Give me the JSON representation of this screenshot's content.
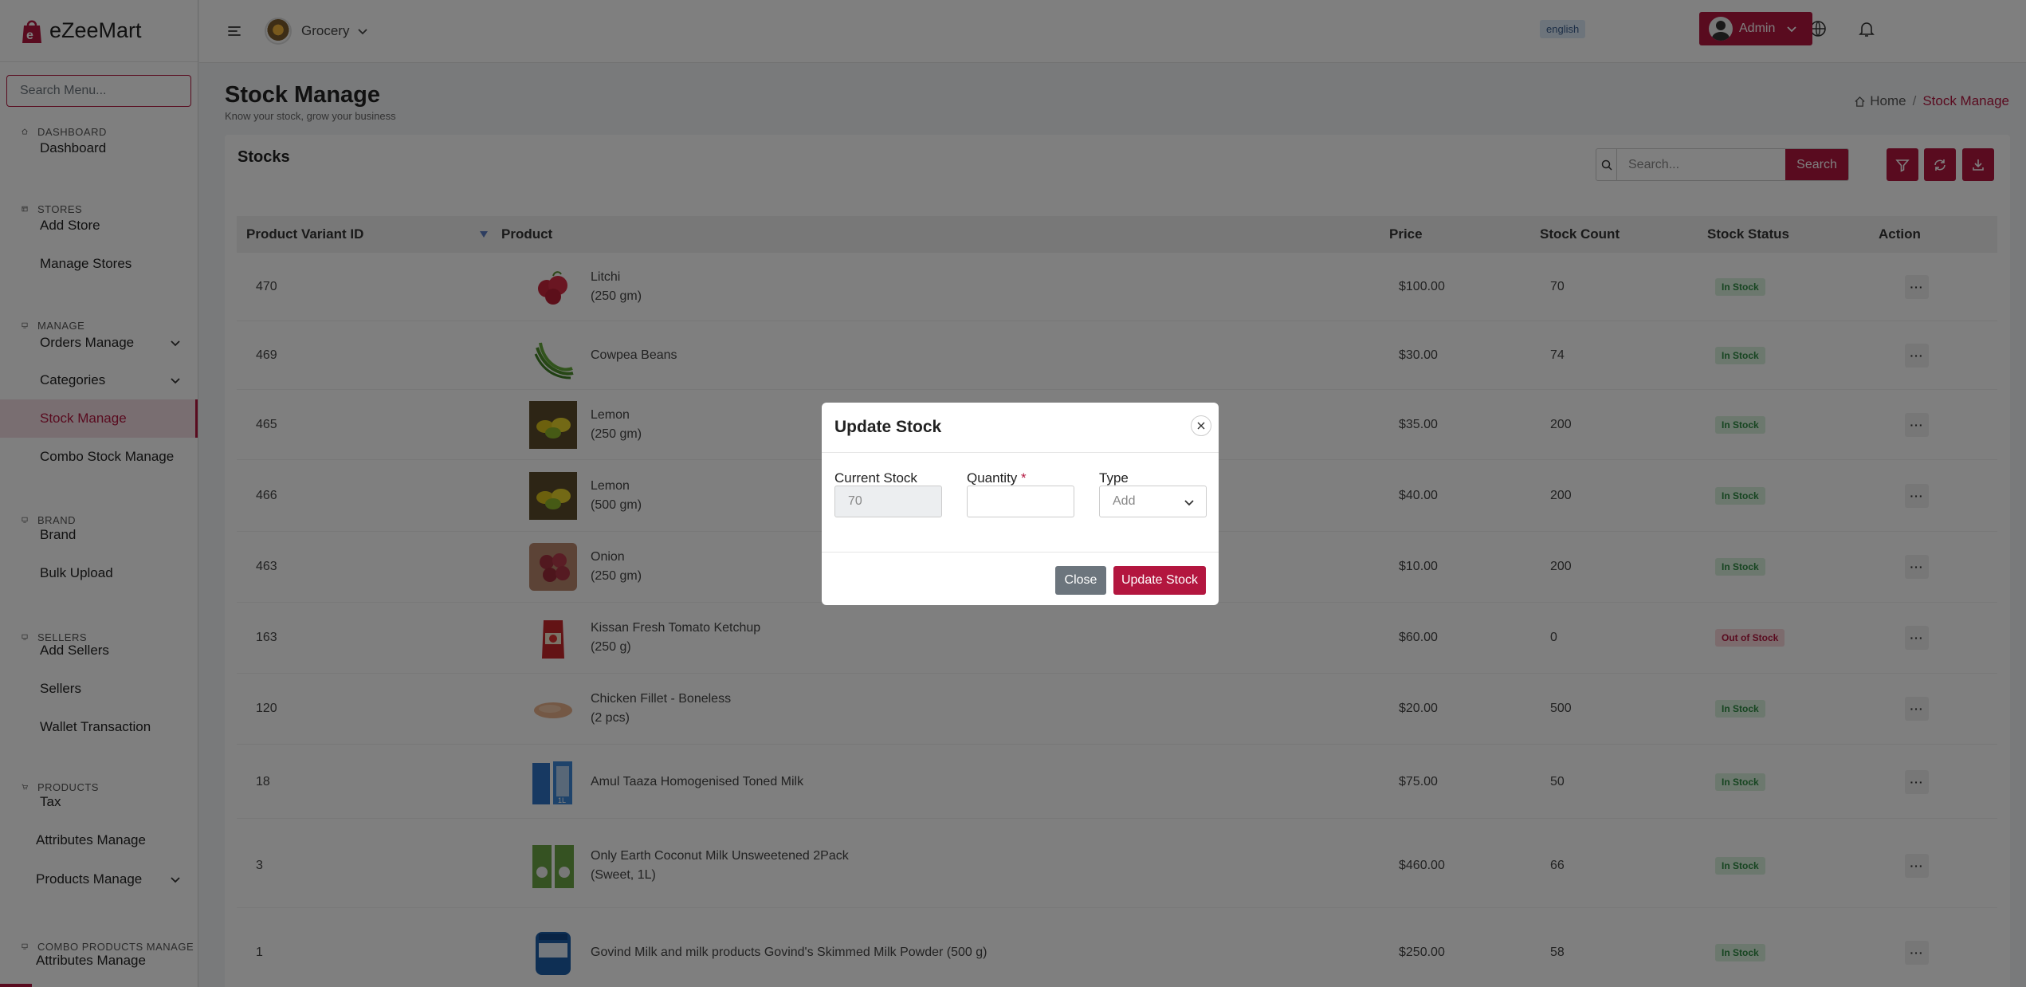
{
  "app": {
    "brand": "eZeeMart"
  },
  "sidebar": {
    "search_placeholder": "Search Menu...",
    "sections": [
      {
        "title": "DASHBOARD",
        "icon": "home-icon",
        "items": [
          {
            "label": "Dashboard"
          }
        ]
      },
      {
        "title": "STORES",
        "icon": "store-icon",
        "items": [
          {
            "label": "Add Store"
          },
          {
            "label": "Manage Stores"
          }
        ]
      },
      {
        "title": "MANAGE",
        "icon": "monitor-icon",
        "items": [
          {
            "label": "Orders Manage",
            "chevron": true
          },
          {
            "label": "Categories",
            "chevron": true
          },
          {
            "label": "Stock Manage",
            "active": true
          },
          {
            "label": "Combo Stock Manage"
          }
        ]
      },
      {
        "title": "BRAND",
        "icon": "monitor-icon",
        "items": [
          {
            "label": "Brand"
          },
          {
            "label": "Bulk Upload"
          }
        ]
      },
      {
        "title": "SELLERS",
        "icon": "monitor-icon",
        "items": [
          {
            "label": "Add Sellers"
          },
          {
            "label": "Sellers"
          },
          {
            "label": "Wallet Transaction"
          }
        ]
      },
      {
        "title": "PRODUCTS",
        "icon": "cart-icon",
        "items": [
          {
            "label": "Tax"
          },
          {
            "label": "Attributes Manage"
          },
          {
            "label": "Products Manage",
            "chevron": true
          }
        ]
      },
      {
        "title": "COMBO PRODUCTS MANAGE",
        "icon": "monitor-icon",
        "items": [
          {
            "label": "Attributes Manage"
          }
        ]
      }
    ]
  },
  "topbar": {
    "store_name": "Grocery",
    "language": "english",
    "user": "Admin"
  },
  "page": {
    "title": "Stock Manage",
    "subtitle": "Know your stock, grow your business",
    "breadcrumb_home": "Home",
    "breadcrumb_sep": "/",
    "breadcrumb_current": "Stock Manage"
  },
  "stocks": {
    "title": "Stocks",
    "search_placeholder": "Search...",
    "search_button": "Search",
    "columns": {
      "id": "Product Variant ID",
      "product": "Product",
      "price": "Price",
      "count": "Stock Count",
      "status": "Stock Status",
      "action": "Action"
    },
    "rows": [
      {
        "id": "470",
        "name": "Litchi",
        "variant": "(250 gm)",
        "price": "$100.00",
        "count": "70",
        "status": "In Stock",
        "in": true,
        "thumb": "litchi"
      },
      {
        "id": "469",
        "name": "Cowpea Beans",
        "variant": "",
        "price": "$30.00",
        "count": "74",
        "status": "In Stock",
        "in": true,
        "thumb": "beans"
      },
      {
        "id": "465",
        "name": "Lemon",
        "variant": "(250 gm)",
        "price": "$35.00",
        "count": "200",
        "status": "In Stock",
        "in": true,
        "thumb": "lemon"
      },
      {
        "id": "466",
        "name": "Lemon",
        "variant": "(500 gm)",
        "price": "$40.00",
        "count": "200",
        "status": "In Stock",
        "in": true,
        "thumb": "lemon"
      },
      {
        "id": "463",
        "name": "Onion",
        "variant": "(250 gm)",
        "price": "$10.00",
        "count": "200",
        "status": "In Stock",
        "in": true,
        "thumb": "onion"
      },
      {
        "id": "163",
        "name": "Kissan Fresh Tomato Ketchup",
        "variant": "(250 g)",
        "price": "$60.00",
        "count": "0",
        "status": "Out of Stock",
        "in": false,
        "thumb": "ketchup"
      },
      {
        "id": "120",
        "name": "Chicken Fillet - Boneless",
        "variant": "(2 pcs)",
        "price": "$20.00",
        "count": "500",
        "status": "In Stock",
        "in": true,
        "thumb": "chicken"
      },
      {
        "id": "18",
        "name": "Amul Taaza Homogenised Toned Milk",
        "variant": "",
        "price": "$75.00",
        "count": "50",
        "status": "In Stock",
        "in": true,
        "thumb": "milk"
      },
      {
        "id": "3",
        "name": "Only Earth Coconut Milk Unsweetened 2Pack",
        "variant": "(Sweet, 1L)",
        "price": "$460.00",
        "count": "66",
        "status": "In Stock",
        "in": true,
        "thumb": "coconut"
      },
      {
        "id": "1",
        "name": "Govind Milk and milk products Govind's Skimmed Milk Powder (500 g)",
        "variant": "",
        "price": "$250.00",
        "count": "58",
        "status": "In Stock",
        "in": true,
        "thumb": "powder"
      }
    ]
  },
  "modal": {
    "title": "Update Stock",
    "current_stock_label": "Current Stock",
    "current_stock_value": "70",
    "quantity_label": "Quantity",
    "required_mark": "*",
    "quantity_value": "",
    "type_label": "Type",
    "type_value": "Add",
    "close_button": "Close",
    "update_button": "Update Stock"
  },
  "colors": {
    "accent": "#b3163f",
    "in_stock": "#2e8a43",
    "out_stock": "#b3163f"
  }
}
